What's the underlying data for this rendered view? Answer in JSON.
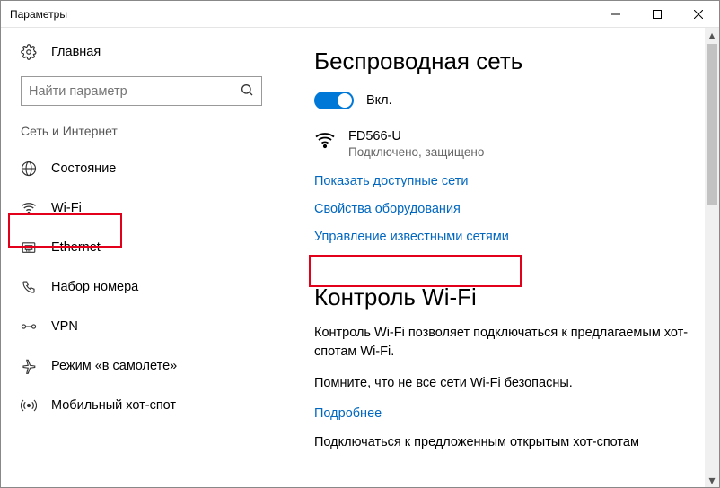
{
  "window": {
    "title": "Параметры"
  },
  "sidebar": {
    "home": "Главная",
    "search_placeholder": "Найти параметр",
    "group": "Сеть и Интернет",
    "items": [
      {
        "label": "Состояние",
        "icon": "globe-icon"
      },
      {
        "label": "Wi-Fi",
        "icon": "wifi-icon"
      },
      {
        "label": "Ethernet",
        "icon": "ethernet-icon"
      },
      {
        "label": "Набор номера",
        "icon": "dialup-icon"
      },
      {
        "label": "VPN",
        "icon": "vpn-icon"
      },
      {
        "label": "Режим «в самолете»",
        "icon": "airplane-icon"
      },
      {
        "label": "Мобильный хот-спот",
        "icon": "hotspot-icon"
      }
    ]
  },
  "main": {
    "page_title": "Беспроводная сеть",
    "toggle_label": "Вкл.",
    "network": {
      "ssid": "FD566-U",
      "status": "Подключено, защищено"
    },
    "link_show_networks": "Показать доступные сети",
    "link_hw_props": "Свойства оборудования",
    "link_known_networks": "Управление известными сетями",
    "wifi_control": {
      "title": "Контроль Wi-Fi",
      "para1": "Контроль Wi-Fi позволяет подключаться к предлагаемым хот-спотам Wi-Fi.",
      "para2": "Помните, что не все сети Wi-Fi безопасны.",
      "link_more": "Подробнее",
      "para3": "Подключаться к предложенным открытым хот-спотам"
    }
  }
}
